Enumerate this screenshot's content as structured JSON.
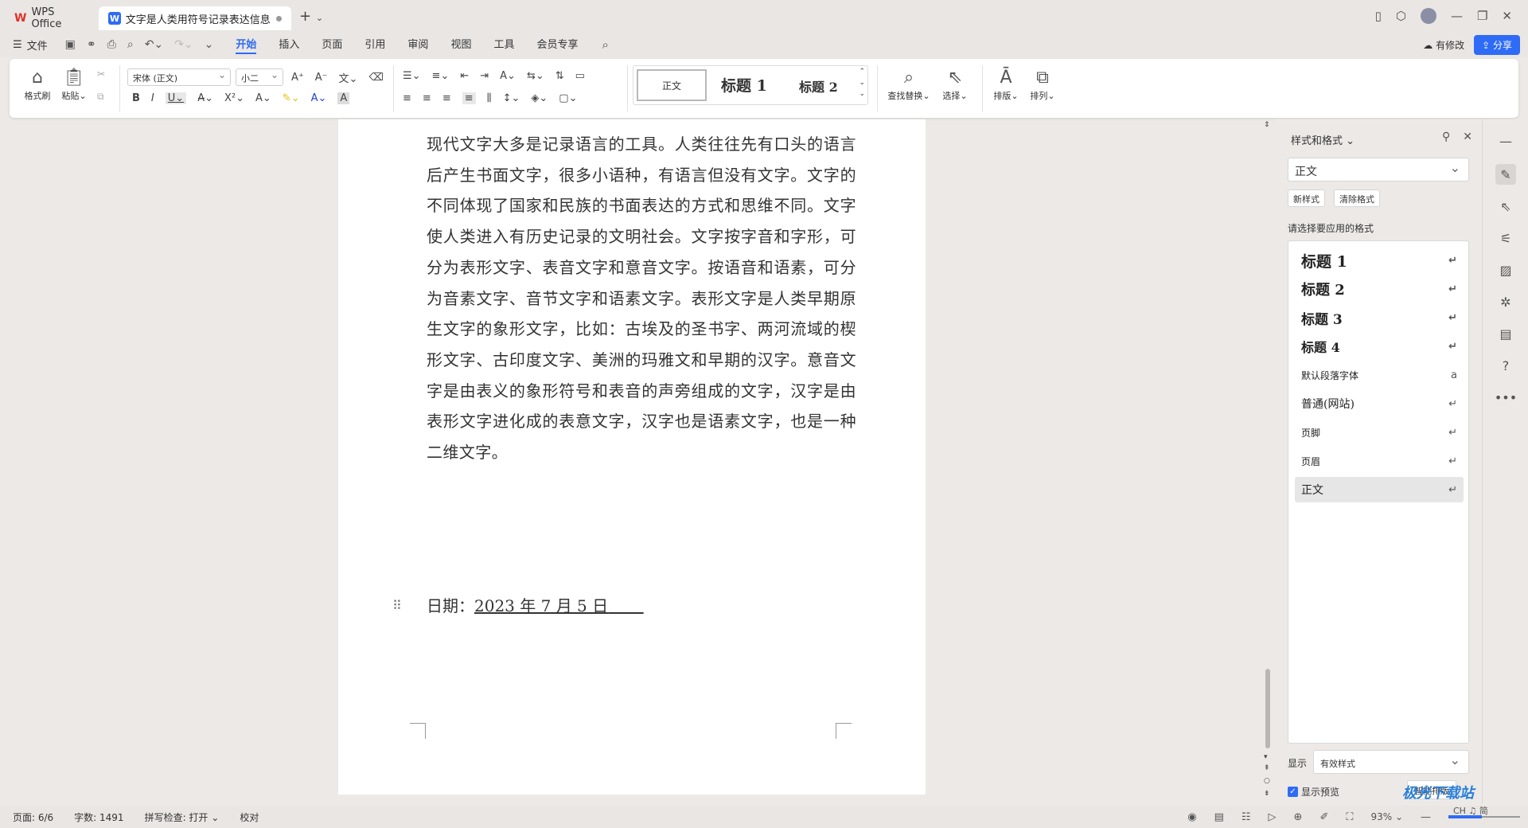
{
  "tabs": {
    "app": "WPS Office",
    "document": "文字是人类用符号记录表达信息以"
  },
  "menu": {
    "file": "文件",
    "items": [
      "开始",
      "插入",
      "页面",
      "引用",
      "审阅",
      "视图",
      "工具",
      "会员专享"
    ],
    "active": "开始",
    "changes": "有修改",
    "share": "分享"
  },
  "ribbon": {
    "format_painter": "格式刷",
    "paste": "粘贴",
    "font_name": "宋体 (正文)",
    "font_size": "小二",
    "styles": {
      "normal": "正文",
      "h1": "标题 1",
      "h2": "标题 2"
    },
    "find_replace": "查找替换",
    "select": "选择",
    "layout": "排版",
    "arrange": "排列"
  },
  "document": {
    "body": "现代文字大多是记录语言的工具。人类往往先有口头的语言后产生书面文字，很多小语种，有语言但没有文字。文字的不同体现了国家和民族的书面表达的方式和思维不同。文字使人类进入有历史记录的文明社会。文字按字音和字形，可分为表形文字、表音文字和意音文字。按语音和语素，可分为音素文字、音节文字和语素文字。表形文字是人类早期原生文字的象形文字，比如：古埃及的圣书字、两河流域的楔形文字、古印度文字、美洲的玛雅文和早期的汉字。意音文字是由表义的象形符号和表音的声旁组成的文字，汉字是由表形文字进化成的表意文字，汉字也是语素文字，也是一种二维文字。",
    "date_label": "日期：",
    "date_value": "2023 年 7 月 5 日"
  },
  "pane": {
    "title": "样式和格式",
    "current_style": "正文",
    "new_style": "新样式",
    "clear_format": "清除格式",
    "apply_label": "请选择要应用的格式",
    "styles": [
      {
        "name": "标题  1",
        "mark": "↵"
      },
      {
        "name": "标题  2",
        "mark": "↵"
      },
      {
        "name": "标题  3",
        "mark": "↵"
      },
      {
        "name": "标题  4",
        "mark": "↵"
      },
      {
        "name": "默认段落字体",
        "mark": "a"
      },
      {
        "name": "普通(网站)",
        "mark": "↵"
      },
      {
        "name": "页脚",
        "mark": "↵"
      },
      {
        "name": "页眉",
        "mark": "↵"
      },
      {
        "name": "正文",
        "mark": "↵"
      }
    ],
    "selected_style": "正文",
    "show_label": "显示",
    "show_value": "有效样式",
    "preview_label": "显示预览",
    "smart_layout": "智能排版"
  },
  "status": {
    "page": "页面: 6/6",
    "words": "字数: 1491",
    "spellcheck": "拼写检查: 打开",
    "proofread": "校对",
    "zoom": "93%",
    "zoom_fraction": 0.93
  },
  "watermark": {
    "brand": "极光下载站",
    "ime": "CH ♫ 简"
  },
  "colors": {
    "accent": "#2e6bf6",
    "wps_red": "#e0302a"
  }
}
